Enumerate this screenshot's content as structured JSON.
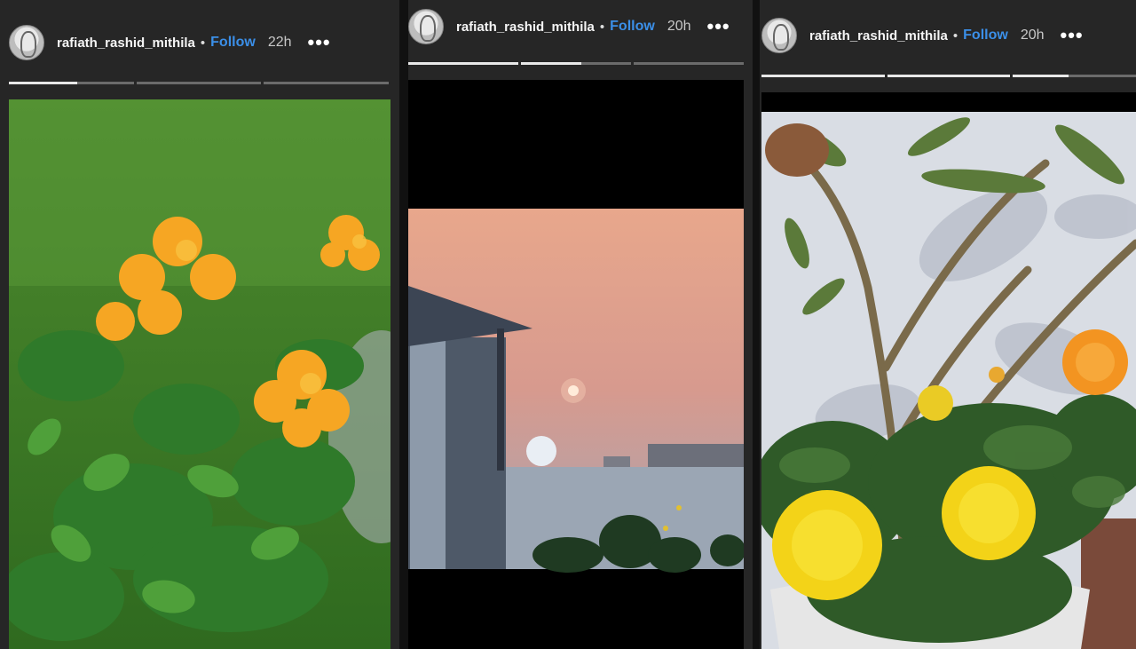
{
  "stories": [
    {
      "username": "rafiath_rashid_mithila",
      "separator": "•",
      "follow_label": "Follow",
      "time": "22h",
      "more_icon": "•••",
      "segments": [
        0.55,
        0,
        0
      ],
      "media": "orange flowers in garden"
    },
    {
      "username": "rafiath_rashid_mithila",
      "separator": "•",
      "follow_label": "Follow",
      "time": "20h",
      "more_icon": "•••",
      "segments": [
        1,
        0.55,
        0
      ],
      "media": "sunset over rooftop"
    },
    {
      "username": "rafiath_rashid_mithila",
      "separator": "•",
      "follow_label": "Follow",
      "time": "20h",
      "more_icon": "•••",
      "segments": [
        1,
        1,
        0.45
      ],
      "media": "marigolds and frangipani plant"
    }
  ],
  "colors": {
    "follow": "#3b8fe8",
    "background": "#262626"
  }
}
